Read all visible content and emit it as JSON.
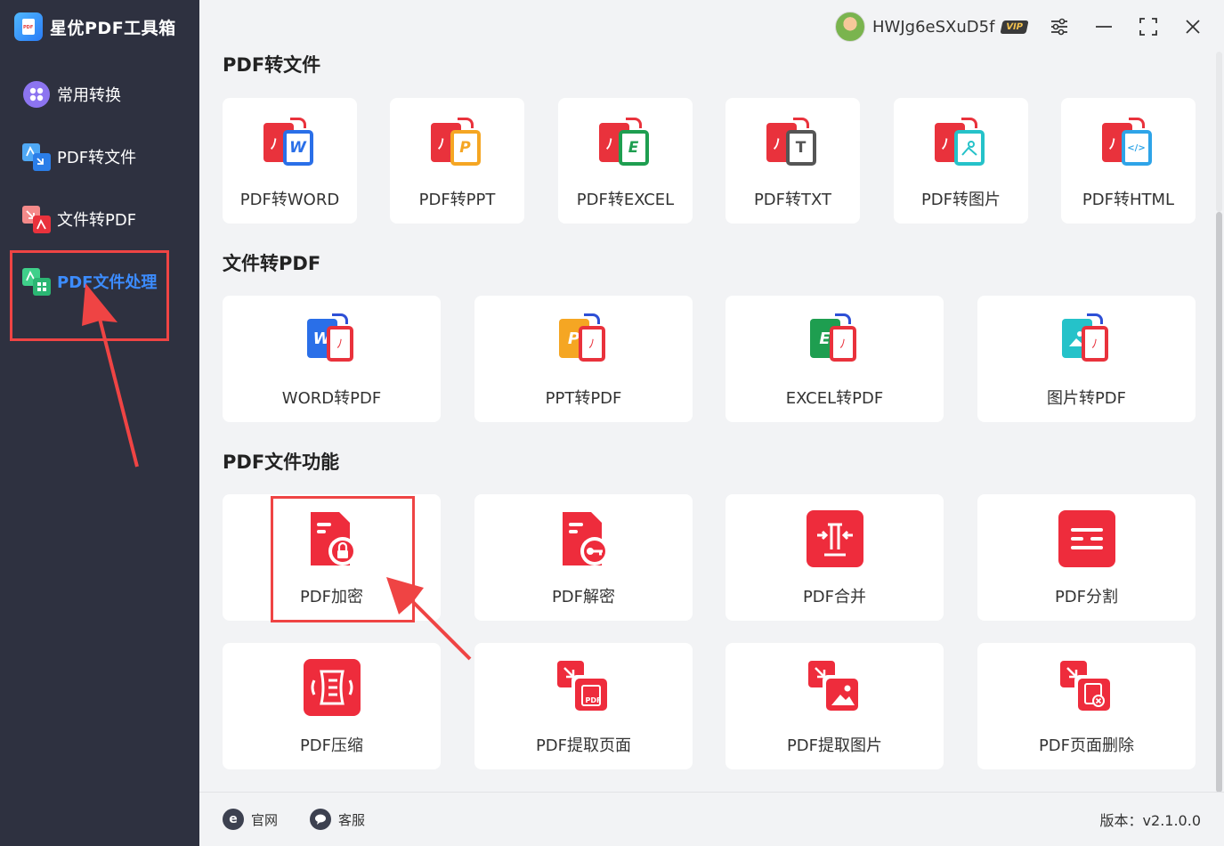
{
  "app": {
    "name": "星优PDF工具箱",
    "logo_icon": "app-logo-icon"
  },
  "sidebar": {
    "items": [
      {
        "label": "常用转换",
        "icon": "grid-icon",
        "active": false
      },
      {
        "label": "PDF转文件",
        "icon": "pdf-to-file-icon",
        "active": false
      },
      {
        "label": "文件转PDF",
        "icon": "file-to-pdf-icon",
        "active": false
      },
      {
        "label": "PDF文件处理",
        "icon": "pdf-process-icon",
        "active": true
      }
    ]
  },
  "header": {
    "username": "HWJg6eSXuD5f",
    "vip_badge": "VIP",
    "window_buttons": [
      "settings-sliders-icon",
      "minimize-icon",
      "maximize-icon",
      "close-icon"
    ]
  },
  "sections": {
    "pdf_to_file": {
      "title": "PDF转文件",
      "items": [
        {
          "label": "PDF转WORD",
          "letter": "W",
          "color": "#2a6fe8"
        },
        {
          "label": "PDF转PPT",
          "letter": "P",
          "color": "#f5a623"
        },
        {
          "label": "PDF转EXCEL",
          "letter": "E",
          "color": "#1e9e50"
        },
        {
          "label": "PDF转TXT",
          "letter": "T",
          "color": "#555555"
        },
        {
          "label": "PDF转图片",
          "letter": "",
          "color": "#25c2c9"
        },
        {
          "label": "PDF转HTML",
          "letter": "</>",
          "color": "#2ea4e8"
        }
      ]
    },
    "file_to_pdf": {
      "title": "文件转PDF",
      "items": [
        {
          "label": "WORD转PDF",
          "letter": "W",
          "color": "#2a6fe8"
        },
        {
          "label": "PPT转PDF",
          "letter": "P",
          "color": "#f5a623"
        },
        {
          "label": "EXCEL转PDF",
          "letter": "E",
          "color": "#1e9e50"
        },
        {
          "label": "图片转PDF",
          "letter": "",
          "color": "#25c2c9"
        }
      ]
    },
    "pdf_functions": {
      "title": "PDF文件功能",
      "items": [
        {
          "label": "PDF加密",
          "icon": "lock-document-icon"
        },
        {
          "label": "PDF解密",
          "icon": "key-document-icon"
        },
        {
          "label": "PDF合并",
          "icon": "merge-icon"
        },
        {
          "label": "PDF分割",
          "icon": "split-icon"
        },
        {
          "label": "PDF压缩",
          "icon": "compress-icon"
        },
        {
          "label": "PDF提取页面",
          "icon": "extract-page-icon",
          "sub": "PDF"
        },
        {
          "label": "PDF提取图片",
          "icon": "extract-image-icon"
        },
        {
          "label": "PDF页面删除",
          "icon": "delete-page-icon"
        }
      ]
    }
  },
  "footer": {
    "website_label": "官网",
    "website_icon_letter": "e",
    "support_label": "客服",
    "version": "版本：v2.1.0.0"
  },
  "colors": {
    "accent": "#3c8cff",
    "brand_red": "#ee2c3c",
    "annotation": "#ef4444",
    "sidebar_bg": "#2e3140"
  }
}
